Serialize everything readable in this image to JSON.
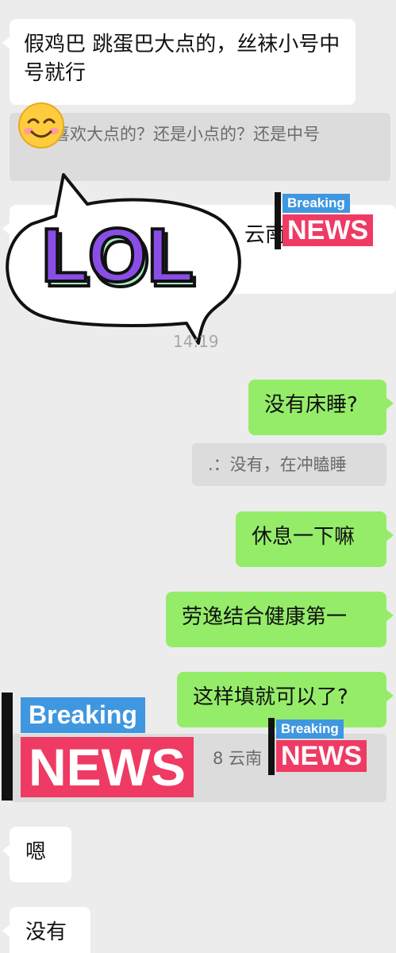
{
  "messages": {
    "m1": "假鸡巴 跳蛋巴大点的，丝袜小号中号就行",
    "q1": "：喜欢大点的？还是小点的？还是中号",
    "m2_frag": "云南",
    "time1": "14:19",
    "m3": "没有床睡?",
    "q2": ".：没有，在冲瞌睡",
    "m4": "休息一下嘛",
    "m5": "劳逸结合健康第一",
    "m6": "这样填就可以了?",
    "q3": "8 云南",
    "m7": "嗯",
    "m8": "没有"
  },
  "stickers": {
    "emoji": "smile-emoji",
    "lol": "LOL",
    "breaking": "Breaking",
    "news": "NEWS"
  },
  "colors": {
    "background": "#ececec",
    "self_bubble": "#95ec69",
    "other_bubble": "#ffffff",
    "news_red": "#ef3a63",
    "breaking_blue": "#3f97e0",
    "lol_purple": "#8a4ee6",
    "lol_mint": "#a7eec2"
  }
}
